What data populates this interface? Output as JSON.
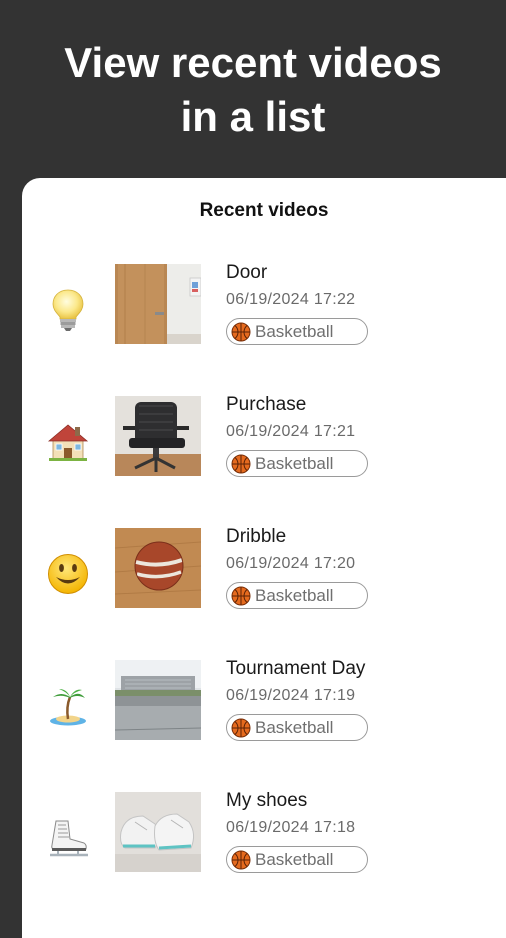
{
  "promo": {
    "headline": "View recent videos in a list"
  },
  "screen": {
    "title": "Recent videos"
  },
  "videos": [
    {
      "emoji": "light-bulb-icon",
      "title": "Door",
      "date": "06/19/2024 17:22",
      "tag": "Basketball"
    },
    {
      "emoji": "house-icon",
      "title": "Purchase",
      "date": "06/19/2024 17:21",
      "tag": "Basketball"
    },
    {
      "emoji": "smiley-face-icon",
      "title": "Dribble",
      "date": "06/19/2024 17:20",
      "tag": "Basketball"
    },
    {
      "emoji": "palm-island-icon",
      "title": "Tournament Day",
      "date": "06/19/2024 17:19",
      "tag": "Basketball"
    },
    {
      "emoji": "ice-skate-icon",
      "title": "My shoes",
      "date": "06/19/2024 17:18",
      "tag": "Basketball"
    }
  ],
  "colors": {
    "background": "#333333",
    "card": "#ffffff",
    "chip_border": "#9a9a9a",
    "basketball": "#e56a1e"
  }
}
